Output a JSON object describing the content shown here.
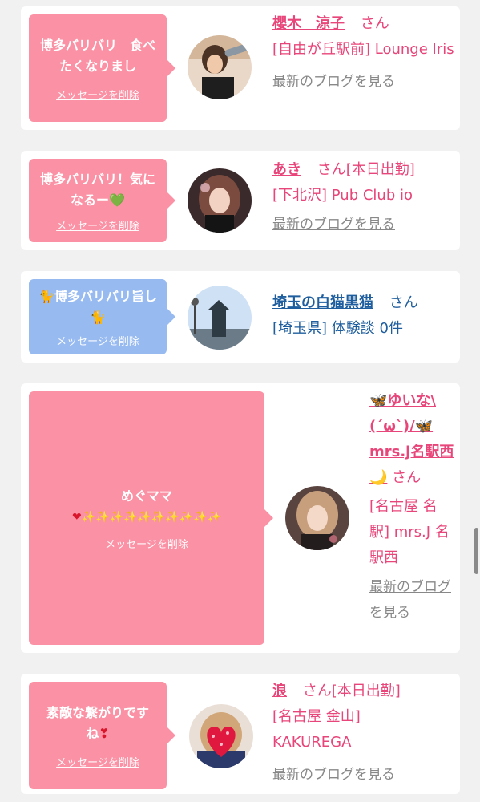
{
  "cards": [
    {
      "message": "博多バリバリ　食べたくなりまし",
      "delete_label": "メッセージを削除",
      "name": "櫻木　涼子",
      "san": "さん",
      "shop": "[自由が丘駅前] Lounge Iris",
      "blog_link": "最新のブログを見る",
      "bubble_color": "#fb91a4"
    },
    {
      "message": "博多バリバリ！気になるー💚",
      "delete_label": "メッセージを削除",
      "name": "あき",
      "san": "さん[本日出勤]",
      "shop": "[下北沢] Pub Club io",
      "blog_link": "最新のブログを見る",
      "bubble_color": "#fb91a4"
    },
    {
      "message": "🐈博多バリバリ旨し🐈",
      "delete_label": "メッセージを削除",
      "name": "埼玉の白猫黒猫",
      "san": "さん",
      "shop": "[埼玉県] 体験談 0件",
      "bubble_color": "#97baf1"
    },
    {
      "message": "めぐママ",
      "message_line2": "✨✨✨✨✨✨✨✨✨✨",
      "delete_label": "メッセージを削除",
      "name": "🦋ゆいな\\(´ω`)/🦋mrs.j名駅西🌙",
      "san": "さん",
      "shop": "[名古屋 名駅] mrs.J 名駅西",
      "blog_link": "最新のブログを見る",
      "bubble_color": "#fb91a4"
    },
    {
      "message": "素敵な繋がりですね",
      "delete_label": "メッセージを削除",
      "name": "浪",
      "san": "さん[本日出勤]",
      "shop": "[名古屋 金山] KAKUREGA",
      "blog_link": "最新のブログを見る",
      "bubble_color": "#fb91a4"
    }
  ],
  "colors": {
    "pink_text": "#e8457a",
    "blue_text": "#1f5e9e",
    "pink_bubble": "#fb91a4",
    "blue_bubble": "#97baf1"
  }
}
